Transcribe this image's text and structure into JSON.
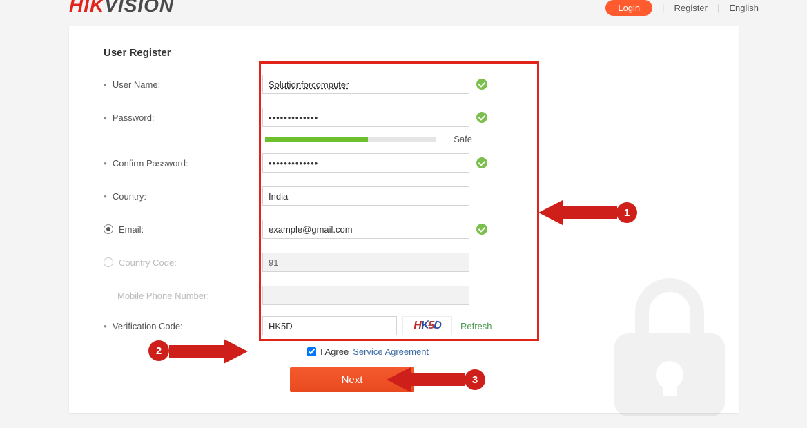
{
  "header": {
    "logo_red": "HIK",
    "logo_dark": "VISION",
    "login": "Login",
    "register": "Register",
    "language": "English"
  },
  "form": {
    "title": "User Register",
    "labels": {
      "username": "User Name:",
      "password": "Password:",
      "confirm": "Confirm Password:",
      "country": "Country:",
      "email": "Email:",
      "country_code": "Country Code:",
      "mobile": "Mobile Phone Number:",
      "verification": "Verification Code:"
    },
    "values": {
      "username": "Solutionforcomputer",
      "password": "•••••••••••••",
      "confirm": "•••••••••••••",
      "country": "India",
      "email": "example@gmail.com",
      "country_code": "91",
      "mobile": "",
      "verification": "HK5D"
    },
    "strength_label": "Safe",
    "captcha_text": "HK5D",
    "refresh_label": "Refresh",
    "agree_label": "I Agree",
    "service_link": "Service Agreement",
    "next_label": "Next"
  },
  "annotations": {
    "step1": "1",
    "step2": "2",
    "step3": "3"
  }
}
